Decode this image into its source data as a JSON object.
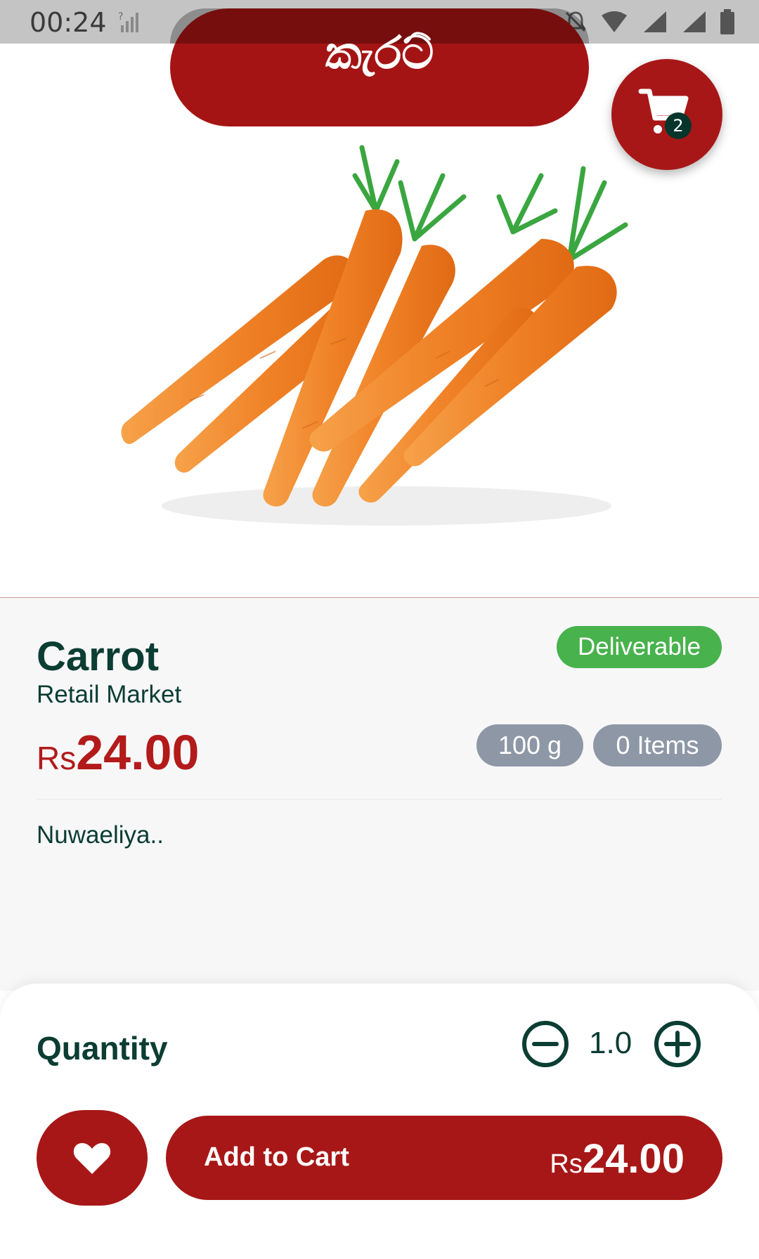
{
  "status_bar": {
    "time": "00:24"
  },
  "header": {
    "title": "කැරට්"
  },
  "cart": {
    "badge_count": "2"
  },
  "product": {
    "name": "Carrot",
    "market": "Retail Market",
    "availability": "Deliverable",
    "price_currency": "Rs",
    "price_value": "24.00",
    "weight": "100 g",
    "stock": "0 Items",
    "description": "Nuwaeliya.."
  },
  "quantity": {
    "label": "Quantity",
    "value": "1.0"
  },
  "actions": {
    "add_to_cart_label": "Add to Cart",
    "total_currency": "Rs",
    "total_value": "24.00"
  },
  "colors": {
    "primary": "#a81717",
    "dark_text": "#0b3d33",
    "available": "#48b24d",
    "chip": "#8e97a6",
    "carrot": "#f28a2e",
    "leaf": "#3aa640"
  }
}
